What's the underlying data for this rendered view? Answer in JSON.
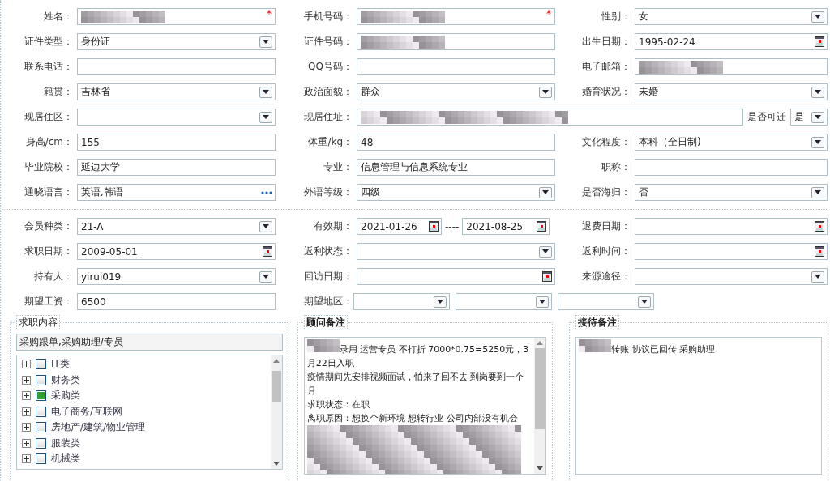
{
  "personal_rows": [
    [
      {
        "kind": "text",
        "label": "姓名：",
        "redacted": true,
        "required_mark": "*"
      },
      {
        "kind": "text",
        "label": "手机号码：",
        "redacted": true,
        "required_mark": "*"
      },
      {
        "kind": "select",
        "label": "性别：",
        "value": "女"
      }
    ],
    [
      {
        "kind": "select",
        "label": "证件类型：",
        "value": "身份证"
      },
      {
        "kind": "text",
        "label": "证件号码：",
        "redacted": true
      },
      {
        "kind": "date",
        "label": "出生日期：",
        "value": "1995-02-24"
      }
    ],
    [
      {
        "kind": "text",
        "label": "联系电话："
      },
      {
        "kind": "text",
        "label": "QQ号码："
      },
      {
        "kind": "text",
        "label": "电子邮箱：",
        "redacted": true
      }
    ],
    [
      {
        "kind": "select",
        "label": "籍贯：",
        "value": "吉林省"
      },
      {
        "kind": "select",
        "label": "政治面貌：",
        "value": "群众"
      },
      {
        "kind": "select",
        "label": "婚育状况：",
        "value": "未婚"
      }
    ],
    [
      {
        "kind": "select",
        "label": "现居住区："
      },
      {
        "kind": "address",
        "label": "现居住址：",
        "redacted": true,
        "extra_label": "是否可迁",
        "extra_value": "是"
      }
    ],
    [
      {
        "kind": "text",
        "label": "身高/cm：",
        "value": "155"
      },
      {
        "kind": "text",
        "label": "体重/kg：",
        "value": "48"
      },
      {
        "kind": "select",
        "label": "文化程度：",
        "value": "本科（全日制)"
      }
    ],
    [
      {
        "kind": "text",
        "label": "毕业院校：",
        "value": "延边大学"
      },
      {
        "kind": "text",
        "label": "专业：",
        "value": "信息管理与信息系统专业"
      },
      {
        "kind": "text",
        "label": "职称："
      }
    ],
    [
      {
        "kind": "lookup",
        "label": "通晓语言：",
        "value": "英语,韩语"
      },
      {
        "kind": "select",
        "label": "外语等级：",
        "value": "四级"
      },
      {
        "kind": "select",
        "label": "是否海归：",
        "value": "否"
      }
    ]
  ],
  "member_rows": [
    [
      {
        "kind": "select",
        "label": "会员种类：",
        "value": "21-A"
      },
      {
        "kind": "date_range",
        "label": "有效期：",
        "values": [
          "2021-01-26",
          "2021-08-25"
        ],
        "separator": "----"
      },
      {
        "kind": "date",
        "label": "退费日期："
      }
    ],
    [
      {
        "kind": "date",
        "label": "求职日期：",
        "value": "2009-05-01"
      },
      {
        "kind": "select",
        "label": "返利状态："
      },
      {
        "kind": "date",
        "label": "返利时间："
      }
    ],
    [
      {
        "kind": "select",
        "label": "持有人：",
        "value": "yirui019"
      },
      {
        "kind": "date",
        "label": "回访日期："
      },
      {
        "kind": "select",
        "label": "来源途径："
      }
    ],
    [
      {
        "kind": "text",
        "label": "期望工资：",
        "value": "6500"
      },
      {
        "kind": "multi_select",
        "label": "期望地区：",
        "dropdowns": [
          {
            "kind": "select"
          },
          {
            "kind": "select"
          },
          {
            "kind": "select"
          }
        ]
      }
    ]
  ],
  "job_content": {
    "legend": "求职内容",
    "selection": "采购跟单,采购助理/专员",
    "tree": [
      {
        "label": "IT类",
        "checked": false,
        "expanded": false
      },
      {
        "label": "财务类",
        "checked": false,
        "expanded": false
      },
      {
        "label": "采购类",
        "checked": true,
        "expanded": false
      },
      {
        "label": "电子商务/互联网",
        "checked": false,
        "expanded": false
      },
      {
        "label": "房地产/建筑/物业管理",
        "checked": false,
        "expanded": false
      },
      {
        "label": "服装类",
        "checked": false,
        "expanded": false
      },
      {
        "label": "机械类",
        "checked": false,
        "expanded": false
      }
    ]
  },
  "consultant_notes": {
    "legend": "顾问备注",
    "lines": [
      {
        "text": "录用  运营专员   不打折 7000*0.75=5250元，3月22日入职",
        "redacted": true
      },
      {
        "text": "疫情期间先安排视频面试，怕来了回不去   到岗要到一个月",
        "redacted": false
      },
      {
        "text": "求职状态：在职",
        "redacted": false
      },
      {
        "text": "离职原因：想换个新环境 想转行业 公司内部没有机会",
        "redacted": false
      }
    ]
  },
  "reception_notes": {
    "legend": "接待备注",
    "lines": [
      {
        "text": "转账 协议已回传 采购助理",
        "redacted": true
      }
    ]
  }
}
